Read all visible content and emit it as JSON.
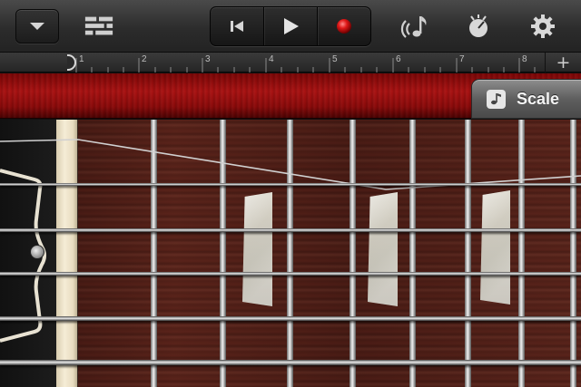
{
  "toolbar": {
    "dropdown_icon": "chevron-down-icon",
    "tracks_icon": "tracks-view-icon",
    "transport": {
      "rewind_icon": "skip-to-start-icon",
      "play_icon": "play-icon",
      "record_icon": "record-icon",
      "record_color": "#e01818"
    },
    "loops_icon": "loop-note-icon",
    "metronome_icon": "metronome-icon",
    "settings_icon": "gear-icon"
  },
  "ruler": {
    "bars": [
      "1",
      "2",
      "3",
      "4",
      "5",
      "6",
      "7",
      "8"
    ],
    "add_label": "+"
  },
  "scale_button": {
    "label": "Scale",
    "icon": "music-note-icon"
  },
  "instrument": {
    "name": "guitar fretboard",
    "accent_color": "#a81212",
    "string_count": 6,
    "fret_count": 9,
    "inlay_count": 3
  }
}
